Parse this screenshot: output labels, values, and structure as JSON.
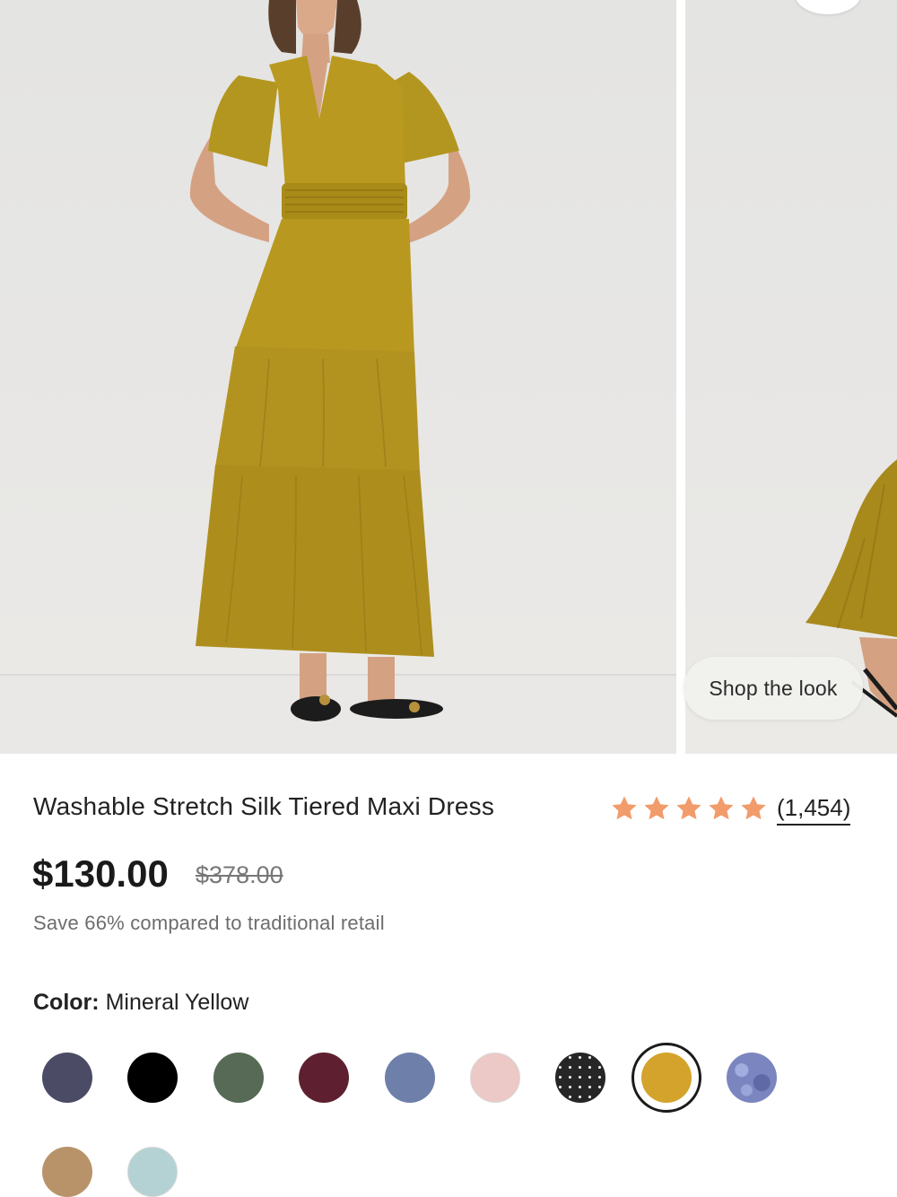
{
  "gallery": {
    "shop_the_look_label": "Shop the look"
  },
  "product": {
    "title": "Washable Stretch Silk Tiered Maxi Dress",
    "rating": 5,
    "review_count": "(1,454)",
    "price": "$130.00",
    "original_price": "$378.00",
    "savings_text": "Save 66% compared to traditional retail"
  },
  "colors": {
    "label": "Color:",
    "selected_name": "Mineral Yellow",
    "selected_index": 7,
    "swatches": [
      {
        "color": "#4b4b66"
      },
      {
        "color": "#000000"
      },
      {
        "color": "#566a55"
      },
      {
        "color": "#5e2030"
      },
      {
        "color": "#6e80aa"
      },
      {
        "color": "#ecc9c6"
      },
      {
        "color": "#262626",
        "pattern": "dots"
      },
      {
        "color": "#d3a32b"
      },
      {
        "color": "#7b86c0",
        "pattern": "floral"
      },
      {
        "color": "#b8936a"
      },
      {
        "color": "#b4d2d3"
      }
    ]
  },
  "accent": {
    "star_color": "#f29b6b"
  }
}
